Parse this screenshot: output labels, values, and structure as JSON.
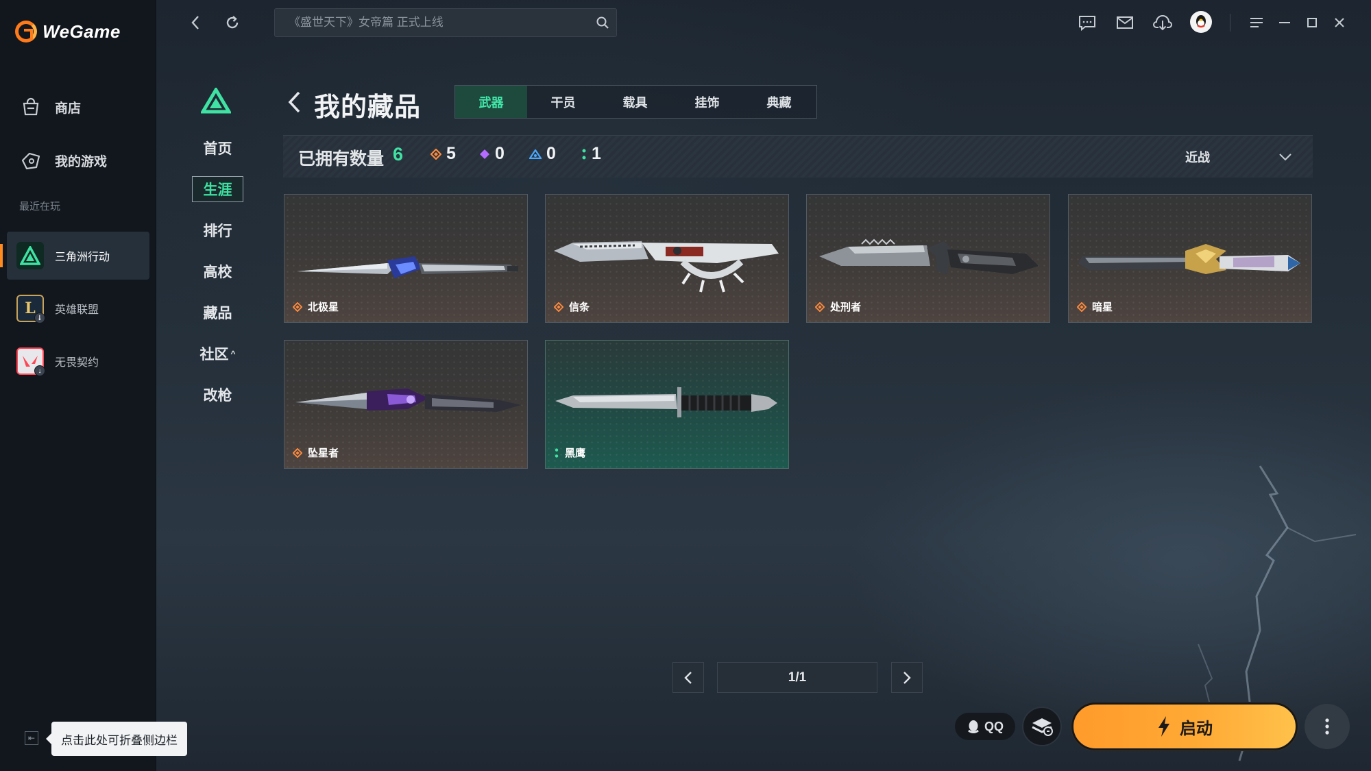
{
  "app": {
    "name": "WeGame"
  },
  "sidebar": {
    "nav": [
      {
        "label": "商店",
        "icon": "store-bag-icon"
      },
      {
        "label": "我的游戏",
        "icon": "gamepad-icon"
      }
    ],
    "recent_label": "最近在玩",
    "recent_games": [
      {
        "label": "三角洲行动",
        "icon": "delta-force-icon",
        "active": true
      },
      {
        "label": "英雄联盟",
        "icon": "league-of-legends-icon",
        "active": false
      },
      {
        "label": "无畏契约",
        "icon": "valorant-icon",
        "active": false
      }
    ],
    "collapse_tooltip": "点击此处可折叠侧边栏"
  },
  "topbar": {
    "search_placeholder": "《盛世天下》女帝篇 正式上线",
    "icons": [
      "back-icon",
      "refresh-icon",
      "search-icon",
      "chat-icon",
      "mail-icon",
      "download-icon",
      "qq-avatar-icon",
      "menu-icon",
      "minimize-icon",
      "maximize-icon",
      "close-icon"
    ]
  },
  "game_nav": {
    "items": [
      {
        "label": "首页",
        "active": false
      },
      {
        "label": "生涯",
        "active": true
      },
      {
        "label": "排行",
        "active": false
      },
      {
        "label": "高校",
        "active": false
      },
      {
        "label": "藏品",
        "active": false
      },
      {
        "label": "社区",
        "active": false,
        "caret": "^"
      },
      {
        "label": "改枪",
        "active": false
      }
    ]
  },
  "collection": {
    "title": "我的藏品",
    "tabs": [
      {
        "label": "武器",
        "active": true
      },
      {
        "label": "干员",
        "active": false
      },
      {
        "label": "载具",
        "active": false
      },
      {
        "label": "挂饰",
        "active": false
      },
      {
        "label": "典藏",
        "active": false
      }
    ],
    "owned_label": "已拥有数量",
    "owned_count": "6",
    "rarity_counts": [
      {
        "tier": "orange",
        "color": "#ff8a3d",
        "count": "5"
      },
      {
        "tier": "purple",
        "color": "#b36cff",
        "count": "0"
      },
      {
        "tier": "blue",
        "color": "#4aa8ff",
        "count": "0"
      },
      {
        "tier": "green",
        "color": "#3fe2a3",
        "count": "1"
      }
    ],
    "filter": {
      "selected": "近战"
    },
    "items": [
      {
        "name": "北极星",
        "rarity": "orange"
      },
      {
        "name": "信条",
        "rarity": "orange"
      },
      {
        "name": "处刑者",
        "rarity": "orange"
      },
      {
        "name": "暗星",
        "rarity": "orange"
      },
      {
        "name": "坠星者",
        "rarity": "orange"
      },
      {
        "name": "黑鹰",
        "rarity": "green"
      }
    ],
    "pagination": {
      "text": "1/1"
    }
  },
  "bottom": {
    "qq_label": "QQ",
    "launch_label": "启动"
  },
  "colors": {
    "accent_green": "#3fe2a3",
    "brand_orange": "#ff7a1a",
    "launch_orange": "#ffa935"
  }
}
